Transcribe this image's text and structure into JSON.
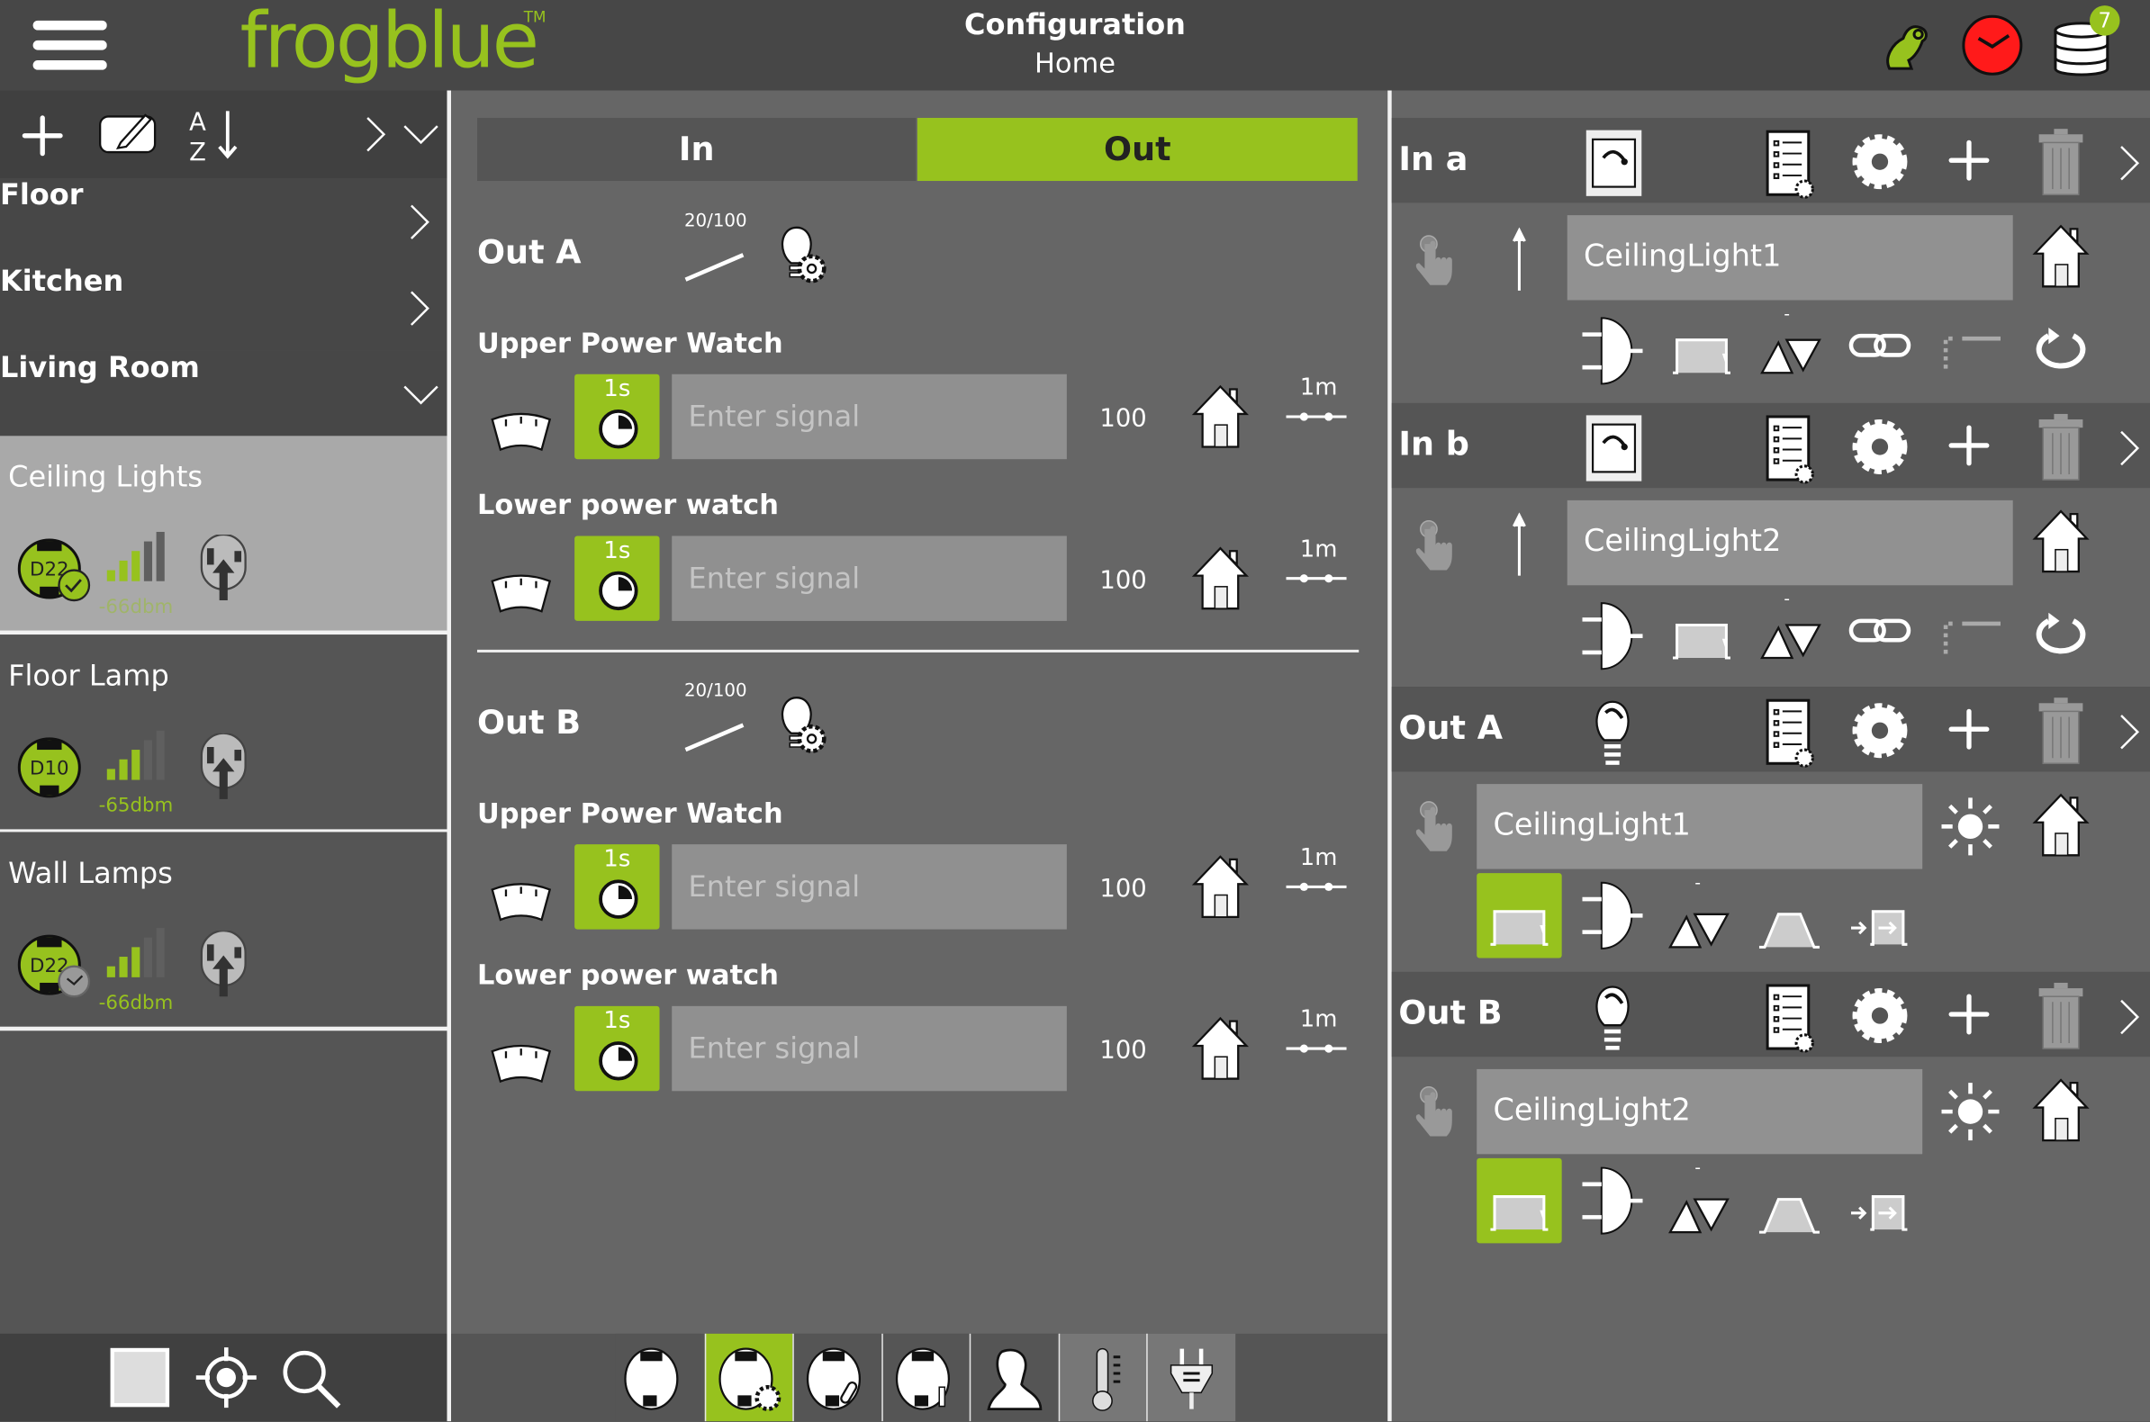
{
  "header": {
    "menu_icon": "hamburger-menu-icon",
    "logo": "frogblue",
    "logo_tm": "TM",
    "title": "Configuration",
    "subtitle": "Home",
    "icons": [
      "frog-icon",
      "red-clock-icon",
      "database-icon"
    ],
    "database_badge": "7"
  },
  "colors": {
    "accent": "#97c21e",
    "topbar": "#474747",
    "panel": "#666666",
    "selected": "#a9a9a9",
    "clock": "#ff1a1a"
  },
  "sidebar": {
    "toolbar_icons": [
      "plus-icon",
      "edit-icon",
      "sort-az-icon",
      "chevron-right-icon",
      "chevron-down-icon"
    ],
    "nav": [
      {
        "label": "Floor",
        "chevron": "right"
      },
      {
        "label": "Kitchen",
        "chevron": "right"
      },
      {
        "label": "Living Room",
        "chevron": "down"
      }
    ],
    "devices": [
      {
        "name": "Ceiling Lights",
        "module": "D22",
        "badge": "check",
        "signal": "-66dbm",
        "selected": true
      },
      {
        "name": "Floor Lamp",
        "module": "D10",
        "badge": "",
        "signal": "-65dbm",
        "selected": false
      },
      {
        "name": "Wall Lamps",
        "module": "D22",
        "badge": "clock",
        "signal": "-66dbm",
        "selected": false
      }
    ],
    "bottom_icons": [
      "square-icon",
      "locate-icon",
      "search-icon"
    ]
  },
  "center": {
    "tabs": [
      {
        "label": "In",
        "active": false
      },
      {
        "label": "Out",
        "active": true
      }
    ],
    "outputs": [
      {
        "title": "Out A",
        "ratio": "20/100",
        "watches": [
          {
            "label": "Upper Power Watch",
            "delay": "1s",
            "placeholder": "Enter signal",
            "value": "100",
            "interval": "1m"
          },
          {
            "label": "Lower power watch",
            "delay": "1s",
            "placeholder": "Enter signal",
            "value": "100",
            "interval": "1m"
          }
        ]
      },
      {
        "title": "Out B",
        "ratio": "20/100",
        "watches": [
          {
            "label": "Upper Power Watch",
            "delay": "1s",
            "placeholder": "Enter signal",
            "value": "100",
            "interval": "1m"
          },
          {
            "label": "Lower power watch",
            "delay": "1s",
            "placeholder": "Enter signal",
            "value": "100",
            "interval": "1m"
          }
        ]
      }
    ],
    "bottom_tabs": [
      {
        "icon": "module-icon",
        "active": false
      },
      {
        "icon": "module-settings-icon",
        "active": true
      },
      {
        "icon": "module-link-icon",
        "active": false
      },
      {
        "icon": "module-info-icon",
        "active": false
      },
      {
        "icon": "user-icon",
        "active": false
      },
      {
        "icon": "thermometer-icon",
        "active": false
      },
      {
        "icon": "plug-icon",
        "active": false
      }
    ]
  },
  "right": {
    "sections": [
      {
        "title": "In a",
        "kind": "in",
        "name": "CeilingLight1",
        "dash": "-"
      },
      {
        "title": "In b",
        "kind": "in",
        "name": "CeilingLight2",
        "dash": "-"
      },
      {
        "title": "Out A",
        "kind": "out",
        "name": "CeilingLight1",
        "dash": "-"
      },
      {
        "title": "Out B",
        "kind": "out",
        "name": "CeilingLight2",
        "dash": "-"
      }
    ]
  }
}
